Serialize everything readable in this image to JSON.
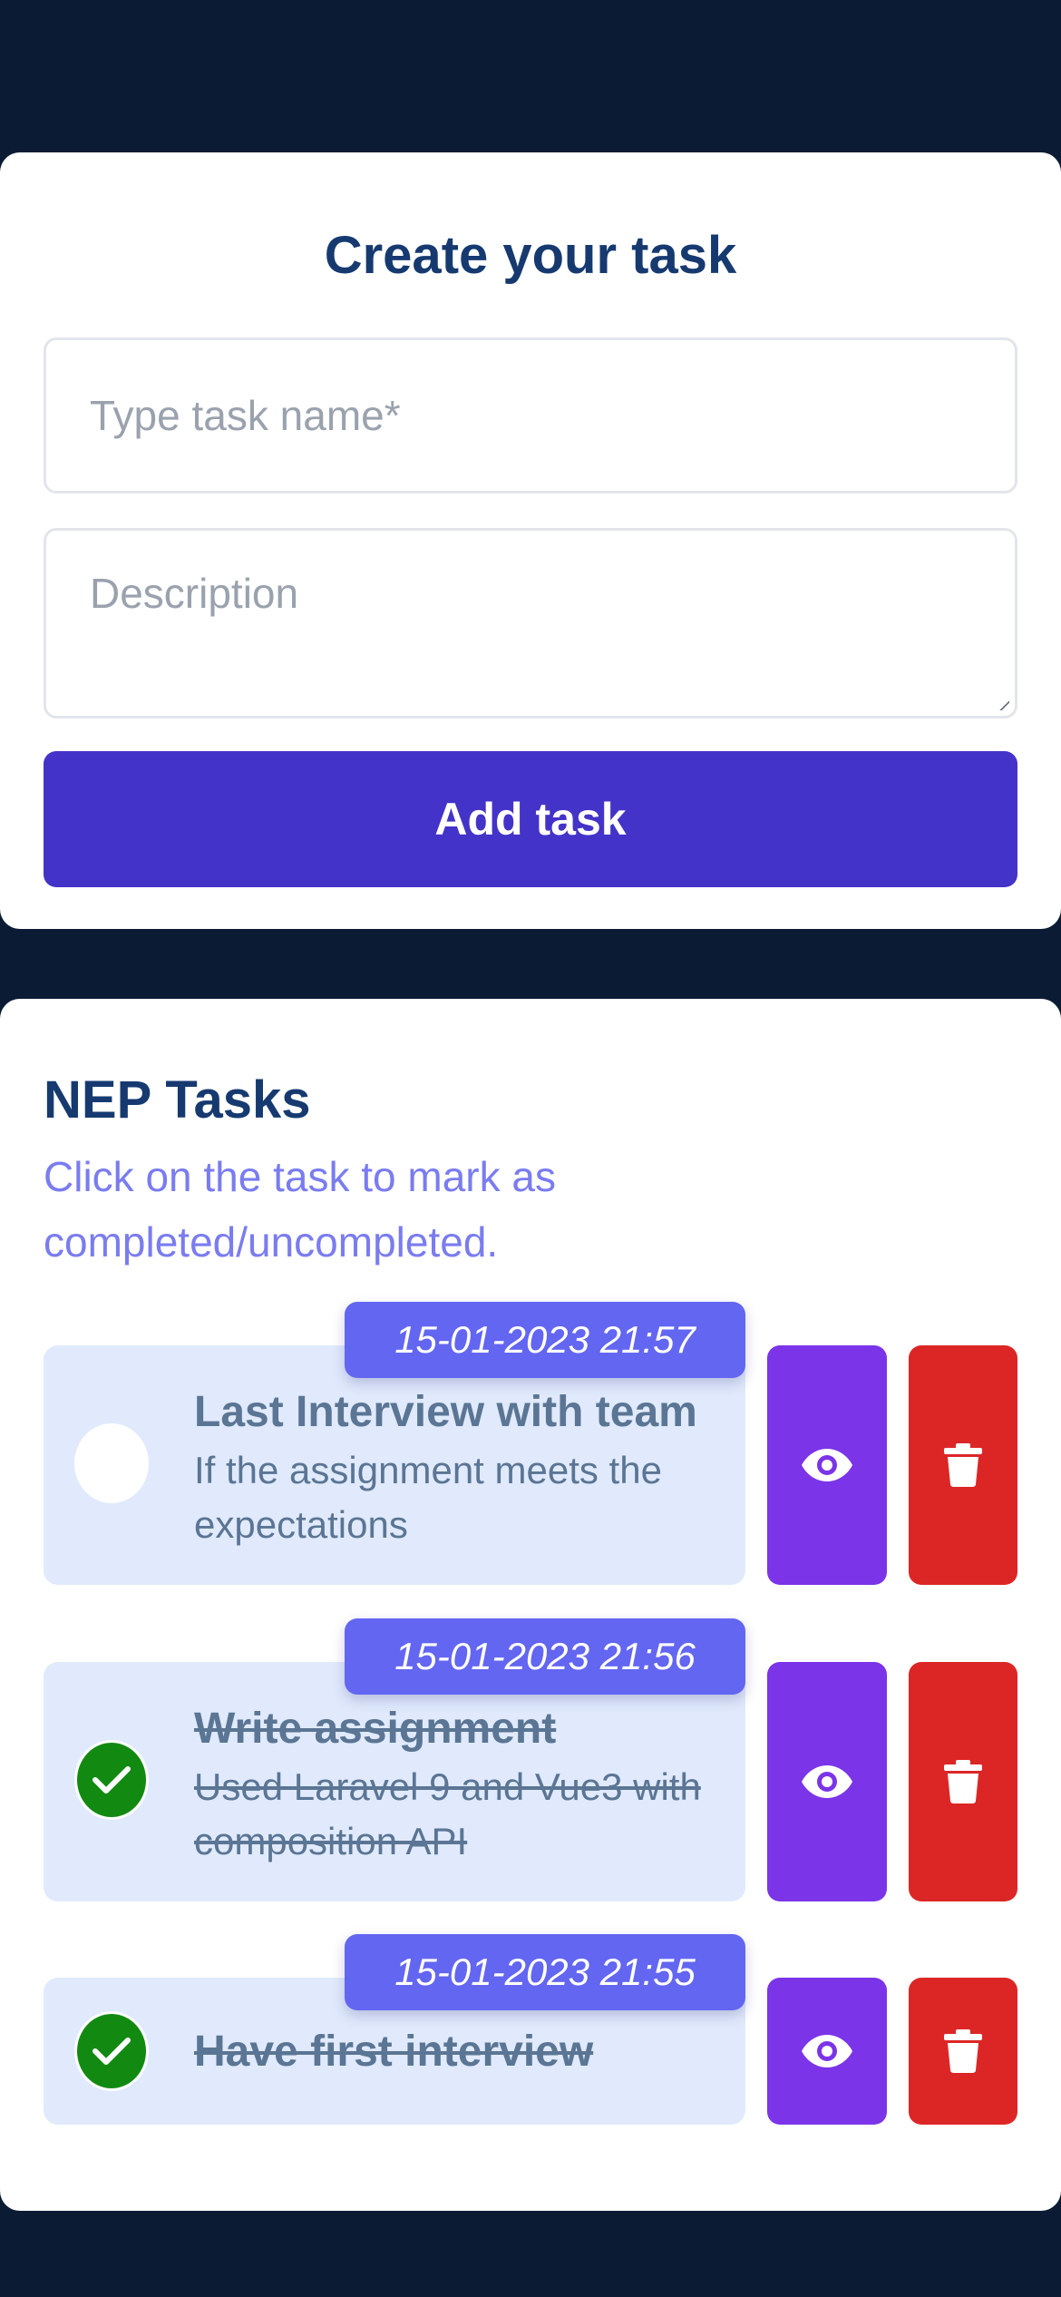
{
  "create": {
    "title": "Create your task",
    "task_name_placeholder": "Type task name*",
    "description_placeholder": "Description",
    "add_button_label": "Add task"
  },
  "tasks_section": {
    "title": "NEP Tasks",
    "hint": "Click on the task to mark as completed/uncompleted."
  },
  "tasks": [
    {
      "date": "15-01-2023 21:57",
      "title": "Last Interview with team",
      "description": "If the assignment meets the expectations",
      "completed": false,
      "view_icon": "eye-icon",
      "delete_icon": "trash-icon"
    },
    {
      "date": "15-01-2023 21:56",
      "title": "Write assignment",
      "description": "Used Laravel 9 and Vue3 with composition API",
      "completed": true,
      "view_icon": "eye-icon",
      "delete_icon": "trash-icon"
    },
    {
      "date": "15-01-2023 21:55",
      "title": "Have first interview",
      "description": "",
      "completed": true,
      "view_icon": "eye-icon",
      "delete_icon": "trash-icon"
    }
  ],
  "colors": {
    "background": "#0b1b33",
    "heading": "#163a70",
    "accent_button": "#4433c8",
    "hint_text": "#7a7cf0",
    "date_badge": "#6366f1",
    "view_button": "#7b34e8",
    "delete_button": "#dc2626",
    "completed_check": "#128a12",
    "task_card": "#e0eafc"
  }
}
